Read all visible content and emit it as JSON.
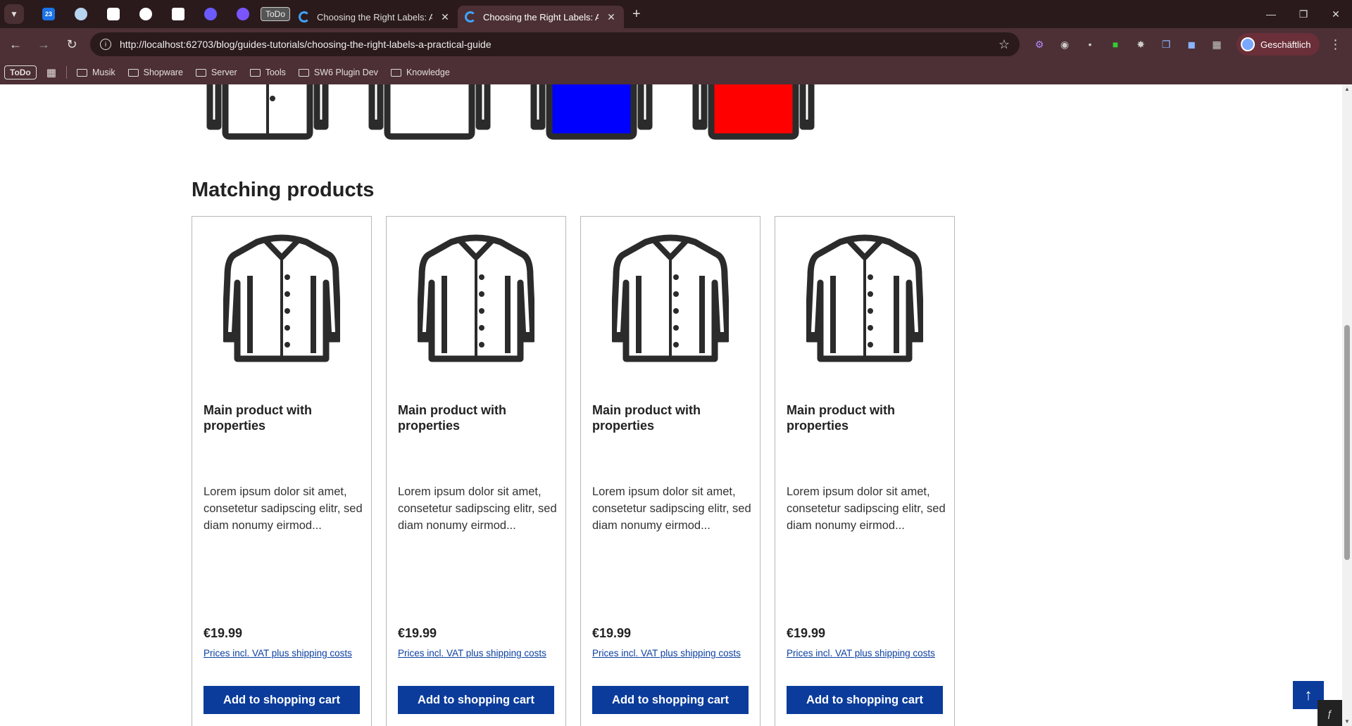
{
  "browser": {
    "pinned_todo": "ToDo",
    "pinned_badge": "23",
    "tabs": [
      {
        "title": "Choosing the Right Labels: A Practical Guide"
      },
      {
        "title": "Choosing the Right Labels: A Practical Guide"
      }
    ],
    "url": "http://localhost:62703/blog/guides-tutorials/choosing-the-right-labels-a-practical-guide",
    "profile_label": "Geschäftlich",
    "bookmarks": {
      "todo": "ToDo",
      "folders": [
        "Musik",
        "Shopware",
        "Server",
        "Tools",
        "SW6 Plugin Dev",
        "Knowledge"
      ]
    }
  },
  "page": {
    "section_title": "Matching products",
    "variant_colors": [
      "#ffffff",
      "#ffffff",
      "#0000ff",
      "#ff0000"
    ],
    "products": [
      {
        "name": "Main product with properties",
        "description": "Lorem ipsum dolor sit amet, consetetur sadipscing elitr, sed diam nonumy eirmod...",
        "price": "€19.99",
        "vat": "Prices incl. VAT plus shipping costs",
        "cart_label": "Add to shopping cart"
      },
      {
        "name": "Main product with properties",
        "description": "Lorem ipsum dolor sit amet, consetetur sadipscing elitr, sed diam nonumy eirmod...",
        "price": "€19.99",
        "vat": "Prices incl. VAT plus shipping costs",
        "cart_label": "Add to shopping cart"
      },
      {
        "name": "Main product with properties",
        "description": "Lorem ipsum dolor sit amet, consetetur sadipscing elitr, sed diam nonumy eirmod...",
        "price": "€19.99",
        "vat": "Prices incl. VAT plus shipping costs",
        "cart_label": "Add to shopping cart"
      },
      {
        "name": "Main product with properties",
        "description": "Lorem ipsum dolor sit amet, consetetur sadipscing elitr, sed diam nonumy eirmod...",
        "price": "€19.99",
        "vat": "Prices incl. VAT plus shipping costs",
        "cart_label": "Add to shopping cart"
      }
    ],
    "accent_color": "#0b3c9c"
  }
}
